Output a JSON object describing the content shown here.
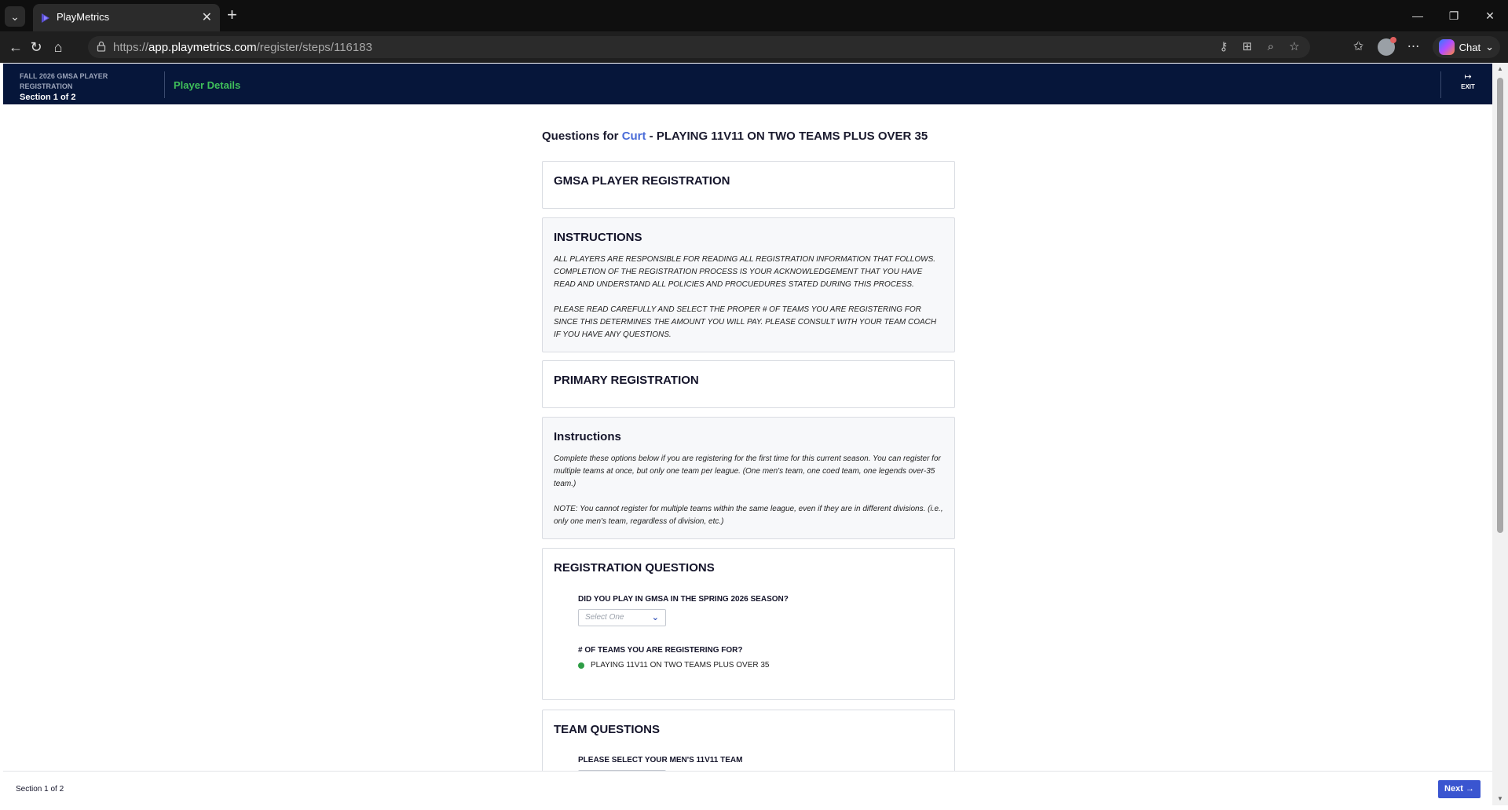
{
  "browser": {
    "tab_title": "PlayMetrics",
    "url_prefix": "https://",
    "url_host": "app.playmetrics.com",
    "url_path": "/register/steps/116183",
    "chat_label": "Chat"
  },
  "header": {
    "registration_title": "FALL 2026 GMSA PLAYER REGISTRATION",
    "section": "Section 1 of 2",
    "step": "Player Details",
    "exit_label": "EXIT"
  },
  "page": {
    "heading_prefix": "Questions for ",
    "player_name": "Curt",
    "heading_suffix": " - PLAYING 11V11 ON TWO TEAMS PLUS OVER 35"
  },
  "cards": {
    "gmsa": {
      "title": "GMSA PLAYER REGISTRATION"
    },
    "instructions_upper": {
      "title": "INSTRUCTIONS",
      "para1": "ALL PLAYERS ARE RESPONSIBLE FOR READING ALL REGISTRATION INFORMATION THAT FOLLOWS. COMPLETION OF THE REGISTRATION PROCESS IS YOUR ACKNOWLEDGEMENT THAT YOU HAVE READ AND UNDERSTAND ALL POLICIES AND PROCUEDURES STATED DURING THIS PROCESS.",
      "para2": "PLEASE READ CAREFULLY AND SELECT THE PROPER # OF TEAMS YOU ARE REGISTERING FOR SINCE THIS DETERMINES THE AMOUNT YOU WILL PAY. PLEASE CONSULT WITH YOUR TEAM COACH IF YOU HAVE ANY QUESTIONS."
    },
    "primary": {
      "title": "PRIMARY REGISTRATION"
    },
    "instructions": {
      "title": "Instructions",
      "para1": "Complete these options below if you are registering for the first time for this current season. You can register for multiple teams at once, but only one team per league. (One men's team, one coed team, one legends over-35 team.)",
      "para2": "NOTE: You cannot register for multiple teams within the same league, even if they are in different divisions. (i.e., only one men's team, regardless of division, etc.)"
    },
    "registration_questions": {
      "title": "REGISTRATION QUESTIONS",
      "q1_label": "DID YOU PLAY IN GMSA IN THE SPRING 2026 SEASON?",
      "q1_placeholder": "Select One",
      "q2_label": "# OF TEAMS YOU ARE REGISTERING FOR?",
      "q2_answer": "PLAYING 11V11 ON TWO TEAMS PLUS OVER 35"
    },
    "team_questions": {
      "title": "TEAM QUESTIONS",
      "q1_label": "PLEASE SELECT YOUR MEN'S 11V11 TEAM"
    }
  },
  "footer": {
    "section": "Section 1 of 2",
    "next_label": "Next"
  },
  "colors": {
    "header_bg": "#06163a",
    "step_green": "#3fbf5a",
    "link_blue": "#4a6cd8",
    "button_blue": "#3a55d0",
    "answer_dot": "#2e9d45"
  }
}
